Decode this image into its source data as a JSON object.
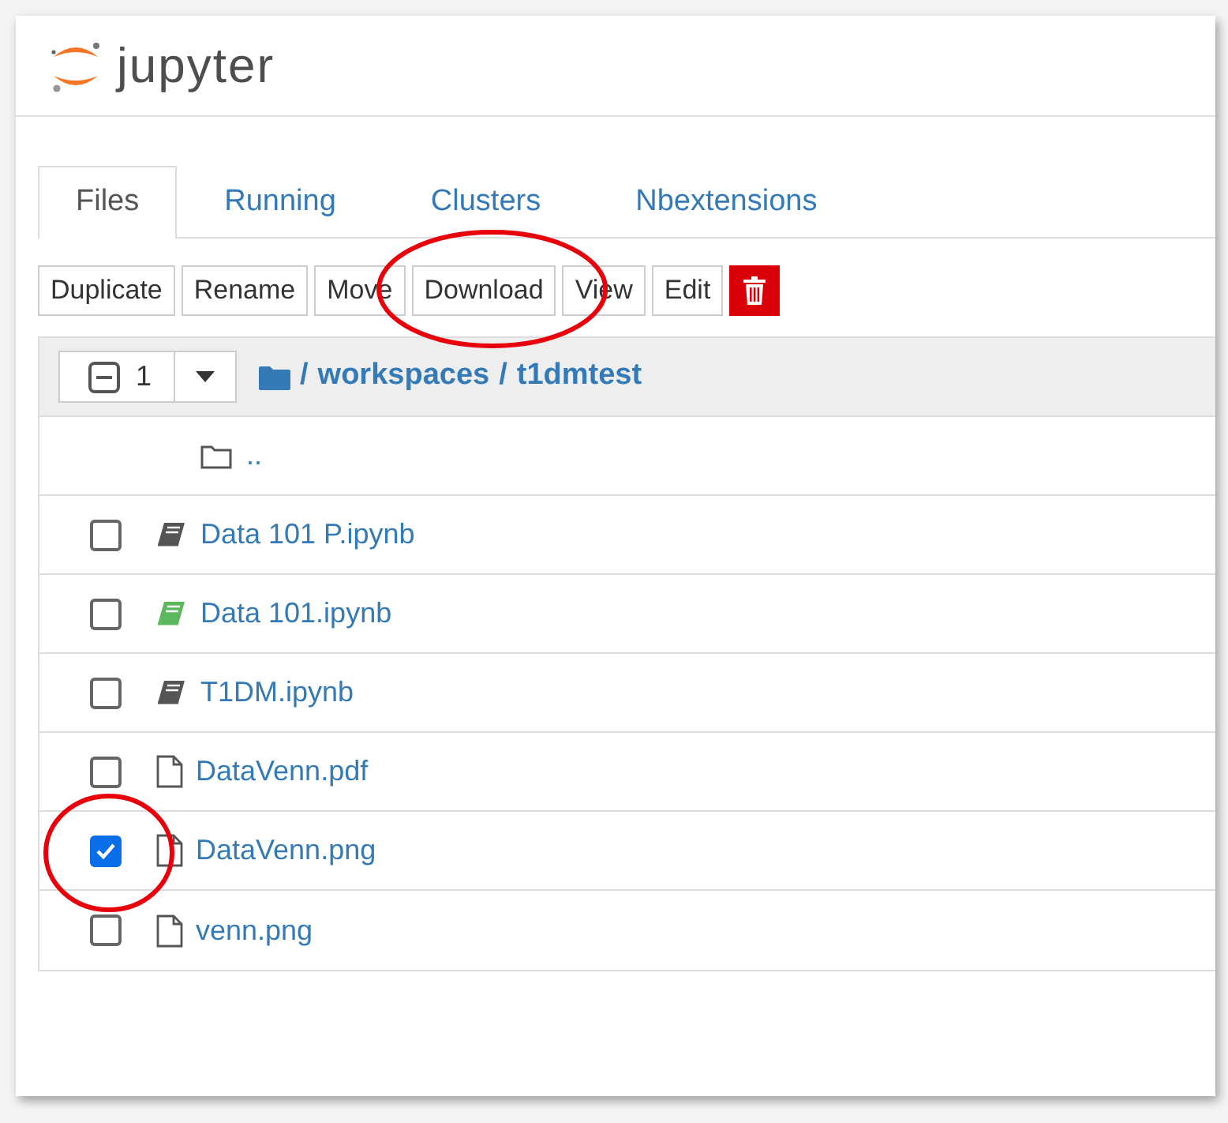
{
  "logo": {
    "text": "jupyter"
  },
  "tabs": [
    {
      "label": "Files",
      "selected": true
    },
    {
      "label": "Running",
      "selected": false
    },
    {
      "label": "Clusters",
      "selected": false
    },
    {
      "label": "Nbextensions",
      "selected": false
    }
  ],
  "toolbar": {
    "buttons": [
      {
        "label": "Duplicate",
        "circled": false
      },
      {
        "label": "Rename",
        "circled": false
      },
      {
        "label": "Move",
        "circled": false
      },
      {
        "label": "Download",
        "circled": true
      },
      {
        "label": "View",
        "circled": false
      },
      {
        "label": "Edit",
        "circled": false
      }
    ],
    "delete_button": true
  },
  "listing": {
    "selected_count": "1",
    "breadcrumb": [
      {
        "label": "/"
      },
      {
        "label": "workspaces"
      },
      {
        "label": "/"
      },
      {
        "label": "t1dmtest"
      }
    ],
    "items": [
      {
        "kind": "parent",
        "name": ".."
      },
      {
        "kind": "notebook",
        "name": "Data 101 P.ipynb",
        "running": false,
        "checked": false,
        "circled": false
      },
      {
        "kind": "notebook",
        "name": "Data 101.ipynb",
        "running": true,
        "checked": false,
        "circled": false
      },
      {
        "kind": "notebook",
        "name": "T1DM.ipynb",
        "running": false,
        "checked": false,
        "circled": false
      },
      {
        "kind": "file",
        "name": "DataVenn.pdf",
        "checked": false,
        "circled": false
      },
      {
        "kind": "file",
        "name": "DataVenn.png",
        "checked": true,
        "circled": true
      },
      {
        "kind": "file",
        "name": "venn.png",
        "checked": false,
        "circled": false
      }
    ]
  }
}
